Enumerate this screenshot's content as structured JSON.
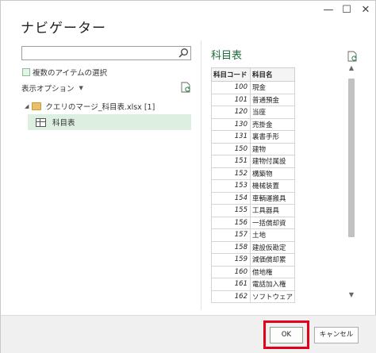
{
  "window": {
    "title": "ナビゲーター",
    "minimize": "—",
    "maximize": "☐",
    "close": "✕"
  },
  "left_pane": {
    "search": {
      "value": "",
      "placeholder": ""
    },
    "multi_select_label": "複数のアイテムの選択",
    "display_options_label": "表示オプション",
    "tree": {
      "folder_label": "クエリのマージ_科目表.xlsx [1]",
      "item_label": "科目表"
    }
  },
  "right_pane": {
    "preview_title": "科目表",
    "columns": [
      "科目コード",
      "科目名"
    ],
    "rows": [
      [
        "100",
        "現金"
      ],
      [
        "101",
        "普通預金"
      ],
      [
        "120",
        "当座"
      ],
      [
        "130",
        "売掛金"
      ],
      [
        "131",
        "裏書手形"
      ],
      [
        "150",
        "建物"
      ],
      [
        "151",
        "建物付属設"
      ],
      [
        "152",
        "構築物"
      ],
      [
        "153",
        "機械装置"
      ],
      [
        "154",
        "車輌運搬具"
      ],
      [
        "155",
        "工具器具"
      ],
      [
        "156",
        "一括償却資"
      ],
      [
        "157",
        "土地"
      ],
      [
        "158",
        "建設仮勘定"
      ],
      [
        "159",
        "減価償却累"
      ],
      [
        "160",
        "借地権"
      ],
      [
        "161",
        "電話加入権"
      ],
      [
        "162",
        "ソフトウェア"
      ]
    ]
  },
  "footer": {
    "ok_label": "OK",
    "cancel_label": "キャンセル"
  },
  "colors": {
    "accent_green": "#1f6b3a",
    "selection_bg": "#dcefe0",
    "highlight_red": "#e3001b"
  }
}
